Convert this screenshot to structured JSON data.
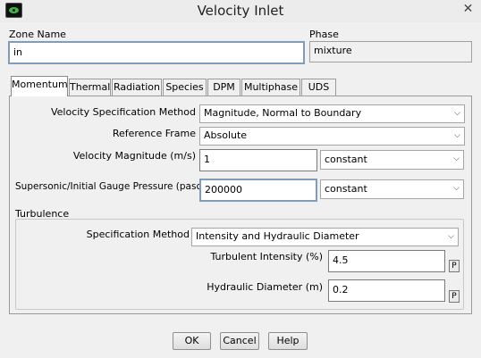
{
  "window": {
    "title": "Velocity Inlet",
    "close_glyph": "✕"
  },
  "zone": {
    "label": "Zone Name",
    "value": "in"
  },
  "phase": {
    "label": "Phase",
    "value": "mixture"
  },
  "tabs": [
    {
      "label": "Momentum",
      "active": true
    },
    {
      "label": "Thermal"
    },
    {
      "label": "Radiation"
    },
    {
      "label": "Species"
    },
    {
      "label": "DPM"
    },
    {
      "label": "Multiphase"
    },
    {
      "label": "UDS"
    }
  ],
  "momentum": {
    "velocity_spec_method": {
      "label": "Velocity Specification Method",
      "value": "Magnitude, Normal to Boundary"
    },
    "reference_frame": {
      "label": "Reference Frame",
      "value": "Absolute"
    },
    "velocity_magnitude": {
      "label": "Velocity Magnitude (m/s)",
      "value": "1",
      "profile": "constant"
    },
    "gauge_pressure": {
      "label": "Supersonic/Initial Gauge Pressure (pascal)",
      "value": "200000",
      "profile": "constant"
    }
  },
  "turbulence": {
    "title": "Turbulence",
    "spec_method": {
      "label": "Specification Method",
      "value": "Intensity and Hydraulic Diameter"
    },
    "intensity": {
      "label": "Turbulent Intensity (%)",
      "value": "4.5",
      "param": "P"
    },
    "hydraulic_diameter": {
      "label": "Hydraulic Diameter (m)",
      "value": "0.2",
      "param": "P"
    }
  },
  "buttons": {
    "ok": "OK",
    "cancel": "Cancel",
    "help": "Help"
  },
  "icons": {
    "dropdown": "chevron-down-icon",
    "app": "fluent-app-icon"
  }
}
